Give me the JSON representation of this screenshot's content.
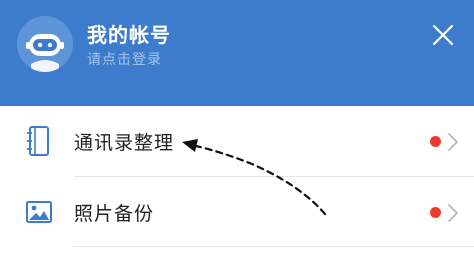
{
  "header": {
    "title": "我的帐号",
    "subtitle": "请点击登录",
    "avatar_icon": "robot-avatar-icon",
    "close_icon": "close-icon",
    "background_color": "#3d7bcd"
  },
  "menu": {
    "items": [
      {
        "label": "通讯录整理",
        "icon": "contacts-book-icon",
        "has_red_dot": true,
        "chevron_icon": "chevron-right-icon"
      },
      {
        "label": "照片备份",
        "icon": "photo-icon",
        "has_red_dot": true,
        "chevron_icon": "chevron-right-icon"
      }
    ]
  },
  "colors": {
    "accent": "#3d7bcd",
    "red_dot": "#ef3b2f",
    "icon_blue": "#3d7bcd",
    "chevron_gray": "#b8b8b8"
  }
}
